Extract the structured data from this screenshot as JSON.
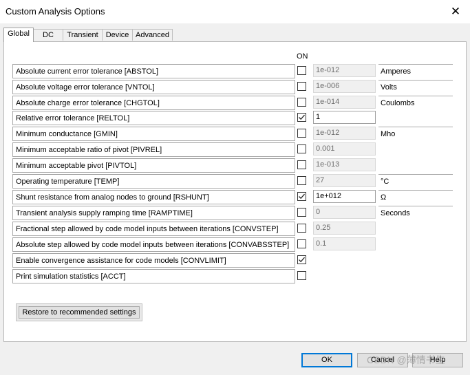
{
  "window": {
    "title": "Custom Analysis Options",
    "close_glyph": "✕"
  },
  "tabs": [
    {
      "label": "Global",
      "active": true
    },
    {
      "label": "DC",
      "active": false
    },
    {
      "label": "Transient",
      "active": false
    },
    {
      "label": "Device",
      "active": false
    },
    {
      "label": "Advanced",
      "active": false
    }
  ],
  "header": {
    "on_label": "ON"
  },
  "rows": [
    {
      "label": "Absolute current error tolerance [ABSTOL]",
      "checked": false,
      "value": "1e-012",
      "editable": false,
      "unit": "Amperes"
    },
    {
      "label": "Absolute voltage error tolerance [VNTOL]",
      "checked": false,
      "value": "1e-006",
      "editable": false,
      "unit": "Volts"
    },
    {
      "label": "Absolute charge error tolerance [CHGTOL]",
      "checked": false,
      "value": "1e-014",
      "editable": false,
      "unit": "Coulombs"
    },
    {
      "label": "Relative error tolerance [RELTOL]",
      "checked": true,
      "value": "1",
      "editable": true,
      "unit": ""
    },
    {
      "label": "Minimum conductance [GMIN]",
      "checked": false,
      "value": "1e-012",
      "editable": false,
      "unit": "Mho"
    },
    {
      "label": "Minimum acceptable ratio of pivot [PIVREL]",
      "checked": false,
      "value": "0.001",
      "editable": false,
      "unit": ""
    },
    {
      "label": "Minimum acceptable pivot [PIVTOL]",
      "checked": false,
      "value": "1e-013",
      "editable": false,
      "unit": ""
    },
    {
      "label": "Operating temperature [TEMP]",
      "checked": false,
      "value": "27",
      "editable": false,
      "unit": "°C"
    },
    {
      "label": "Shunt resistance from analog nodes to ground [RSHUNT]",
      "checked": true,
      "value": "1e+012",
      "editable": true,
      "unit": "Ω"
    },
    {
      "label": "Transient analysis supply ramping time [RAMPTIME]",
      "checked": false,
      "value": "0",
      "editable": false,
      "unit": "Seconds"
    },
    {
      "label": "Fractional step allowed by code model inputs between iterations [CONVSTEP]",
      "checked": false,
      "value": "0.25",
      "editable": false,
      "unit": ""
    },
    {
      "label": "Absolute step allowed by code model inputs between iterations [CONVABSSTEP]",
      "checked": false,
      "value": "0.1",
      "editable": false,
      "unit": ""
    },
    {
      "label": "Enable convergence assistance for code models [CONVLIMIT]",
      "checked": true,
      "value": null,
      "editable": false,
      "unit": ""
    },
    {
      "label": "Print simulation statistics [ACCT]",
      "checked": false,
      "value": null,
      "editable": false,
      "unit": ""
    }
  ],
  "restore_button": "Restore to recommended settings",
  "buttons": {
    "ok": "OK",
    "cancel": "Cancel",
    "help": "Help"
  },
  "watermark": "CSDN @薄情书生"
}
